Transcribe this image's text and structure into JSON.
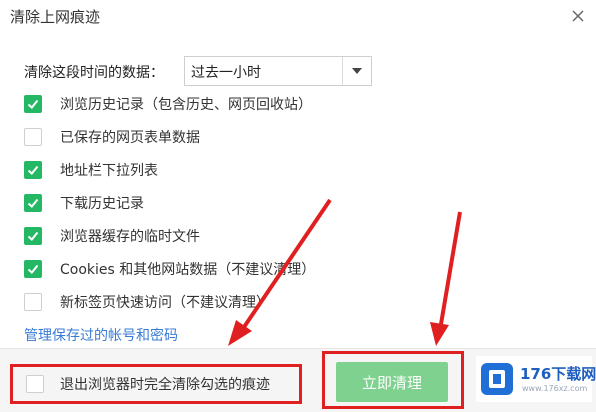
{
  "dialog": {
    "title": "清除上网痕迹",
    "close_icon": "close-icon"
  },
  "time_range": {
    "label": "清除这段时间的数据：",
    "selected": "过去一小时"
  },
  "options": [
    {
      "label": "浏览历史记录（包含历史、网页回收站）",
      "checked": true
    },
    {
      "label": "已保存的网页表单数据",
      "checked": false
    },
    {
      "label": "地址栏下拉列表",
      "checked": true
    },
    {
      "label": "下载历史记录",
      "checked": true
    },
    {
      "label": "浏览器缓存的临时文件",
      "checked": true
    },
    {
      "label": "Cookies 和其他网站数据（不建议清理）",
      "checked": true
    },
    {
      "label": "新标签页快速访问（不建议清理）",
      "checked": false
    }
  ],
  "manage_link": "管理保存过的帐号和密码",
  "footer": {
    "exit_clear_label": "退出浏览器时完全清除勾选的痕迹",
    "exit_clear_checked": false,
    "clear_button": "立即清理"
  },
  "watermark": {
    "text": "176下载网",
    "sub": "www.176xz.com"
  },
  "colors": {
    "check_green": "#25b864",
    "button_green": "#7fd18f",
    "highlight_red": "#e02020",
    "link_blue": "#3a7bd5"
  }
}
